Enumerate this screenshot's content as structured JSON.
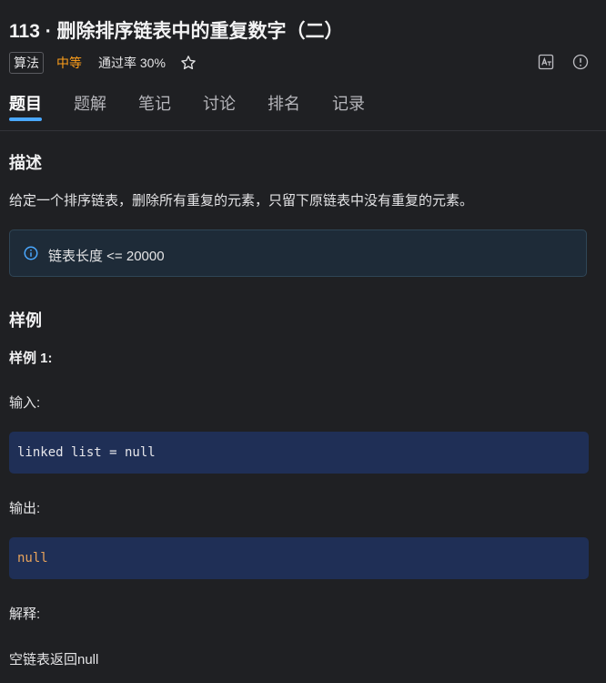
{
  "title": "113 · 删除排序链表中的重复数字（二）",
  "meta": {
    "tag": "算法",
    "difficulty": "中等",
    "pass_rate": "通过率 30%",
    "star_icon": "star-outline-icon",
    "translate_icon": "translate-icon",
    "info_icon": "info-circle-icon"
  },
  "tabs": [
    {
      "label": "题目",
      "active": true
    },
    {
      "label": "题解",
      "active": false
    },
    {
      "label": "笔记",
      "active": false
    },
    {
      "label": "讨论",
      "active": false
    },
    {
      "label": "排名",
      "active": false
    },
    {
      "label": "记录",
      "active": false
    }
  ],
  "description": {
    "heading": "描述",
    "text": "给定一个排序链表，删除所有重复的元素，只留下原链表中没有重复的元素。",
    "note": "链表长度 <= 20000"
  },
  "examples": {
    "heading": "样例",
    "example1": {
      "title": "样例 1:",
      "input_label": "输入:",
      "input_code": "linked list = null",
      "output_label": "输出:",
      "output_code": "null",
      "explain_label": "解释:",
      "explain_text": "空链表返回null"
    }
  },
  "colors": {
    "accent": "#4aa8ff",
    "difficulty": "#ff9f1a",
    "code_bg": "#1f2f56",
    "note_bg": "#1e2b38"
  }
}
